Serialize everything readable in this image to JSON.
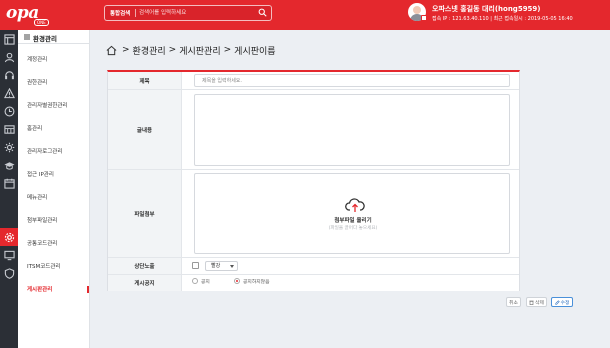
{
  "brand": {
    "logo": "opa",
    "logo_sub": "ONE"
  },
  "search": {
    "type_label": "통합검색",
    "placeholder": "검색어를 입력하세요"
  },
  "user": {
    "name": "오파스넷 홍길동 대리(hong5959)",
    "meta": "접속 IP : 121.63.40.110  |  최근 접속일시 : 2019-05-05 16:40"
  },
  "iconbar": [
    {
      "icon": "dashboard-icon"
    },
    {
      "icon": "person-icon"
    },
    {
      "icon": "headset-icon"
    },
    {
      "icon": "warning-icon"
    },
    {
      "icon": "clock-icon"
    },
    {
      "icon": "server-icon"
    },
    {
      "icon": "gear-cluster-icon"
    },
    {
      "icon": "graduation-cap-icon"
    },
    {
      "icon": "calendar-icon"
    },
    {
      "icon": "settings-icon",
      "active": true
    },
    {
      "icon": "monitor-icon"
    },
    {
      "icon": "shield-icon"
    }
  ],
  "sidebar": {
    "title": "환경관리",
    "items": [
      {
        "label": "계정관리"
      },
      {
        "label": "권한관리"
      },
      {
        "label": "관리자별권한관리"
      },
      {
        "label": "홈관리"
      },
      {
        "label": "관리자로그관리"
      },
      {
        "label": "접근 IP관리"
      },
      {
        "label": "메뉴관리"
      },
      {
        "label": "첨부파일관리"
      },
      {
        "label": "공통코드관리"
      },
      {
        "label": "ITSM코드관리"
      },
      {
        "label": "게시판관리",
        "active": true
      }
    ]
  },
  "breadcrumb": {
    "items": [
      "환경관리",
      "게시판관리",
      "게시판이름"
    ],
    "separator": ">"
  },
  "form": {
    "title_label": "제목",
    "title_placeholder": "제목을 입력하세요.",
    "body_label": "글내용",
    "attach_label": "파일첨부",
    "upload_title": "첨부파일 올리기",
    "upload_hint": "(파일을 끌어다 놓으세요)",
    "top_label": "상단노출",
    "color_select": "빨강",
    "notice_label": "게시공지",
    "notice_options": [
      {
        "label": "공지",
        "checked": false
      },
      {
        "label": "공지하지않음",
        "checked": true
      }
    ]
  },
  "actions": {
    "cancel": "취소",
    "delete": "삭제",
    "edit": "수정"
  },
  "colors": {
    "brand_red": "#e4282d",
    "iconbar_dark": "#2b2f36",
    "primary_blue": "#2a6fc0"
  }
}
